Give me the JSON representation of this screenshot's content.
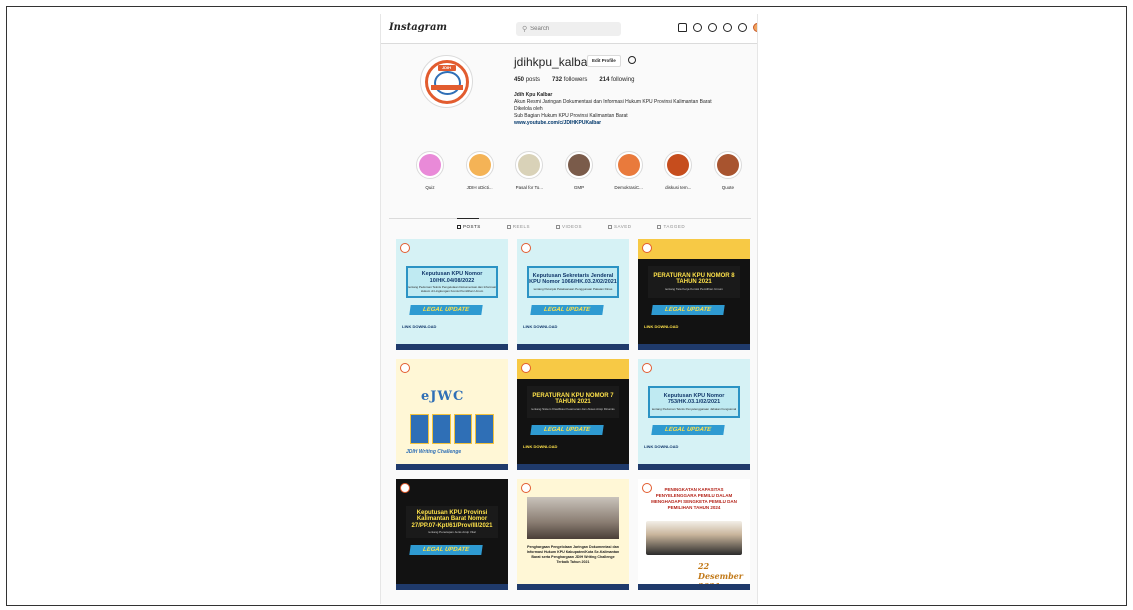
{
  "nav": {
    "logo": "Instagram",
    "search_placeholder": "Search",
    "icons": [
      "home-icon",
      "messenger-icon",
      "new-post-icon",
      "explore-icon",
      "heart-icon",
      "profile-avatar"
    ]
  },
  "profile": {
    "username": "jdihkpu_kalbar",
    "edit_label": "Edit Profile",
    "posts_count": "450",
    "posts_label": "posts",
    "followers_count": "732",
    "followers_label": "followers",
    "following_count": "214",
    "following_label": "following",
    "bio_name": "Jdih Kpu Kalbar",
    "bio_line1": "Akun Resmi Jaringan Dokumentasi dan Informasi Hukum KPU Provinsi Kalimantan Barat",
    "bio_line2": "Dikelola oleh",
    "bio_line3": "Sub Bagian Hukum KPU Provinsi Kalimantan Barat",
    "bio_link": "www.youtube.com/c/JDIHKPUKalbar"
  },
  "highlights": [
    {
      "label": "Quiz",
      "color": "#e98ad8"
    },
    {
      "label": "JDIH xDicti...",
      "color": "#f4b356"
    },
    {
      "label": "Pasal for To...",
      "color": "#d9d2b8"
    },
    {
      "label": "GMP",
      "color": "#7a5b4a"
    },
    {
      "label": "DemokrasiC...",
      "color": "#e97a3c"
    },
    {
      "label": "diskusi tem...",
      "color": "#c64d1d"
    },
    {
      "label": "Quote",
      "color": "#a8542f"
    }
  ],
  "tabs": [
    {
      "label": "POSTS",
      "active": true
    },
    {
      "label": "REELS",
      "active": false
    },
    {
      "label": "VIDEOS",
      "active": false
    },
    {
      "label": "SAVED",
      "active": false
    },
    {
      "label": "TAGGED",
      "active": false
    }
  ],
  "posts": [
    {
      "style": "teal",
      "title": "Keputusan KPU Nomor 10/HK.04/08/2022",
      "sub": "tentang Pedoman Teknis Pengelolaan Dokumentasi dan Informasi Hukum di Lingkungan Komisi Pemilihan Umum",
      "banner": "LEGAL UPDATE",
      "ld": "LINK DOWNLOAD"
    },
    {
      "style": "teal",
      "title": "Keputusan Sekretaris Jenderal KPU Nomor 1066/HK.03.2/02/2021",
      "sub": "tentang Petunjuk Pelaksanaan Penggunaan Pakaian Dinas",
      "banner": "LEGAL UPDATE",
      "ld": "LINK DOWNLOAD"
    },
    {
      "style": "dark yellowtop",
      "title": "PERATURAN KPU NOMOR 8 TAHUN 2021",
      "sub": "tentang Tata Kerja Komisi Pemilihan Umum",
      "banner": "LEGAL UPDATE",
      "ld": "LINK DOWNLOAD"
    },
    {
      "style": "cream",
      "special": "ejwc",
      "logo": "eJWC",
      "caption": "JDIH Writing Challenge"
    },
    {
      "style": "dark yellowtop",
      "title": "PERATURAN KPU NOMOR 7 TAHUN 2021",
      "sub": "tentang Sistem Klasifikasi Keamanan dan Akses Arsip Dinamis",
      "banner": "LEGAL UPDATE",
      "ld": "LINK DOWNLOAD"
    },
    {
      "style": "teal",
      "title": "Keputusan KPU Nomor 753/HK.03.1/02/2021",
      "sub": "tentang Pedoman Teknis Penyelenggaraan Jabatan Fungsional",
      "banner": "LEGAL UPDATE",
      "ld": "LINK DOWNLOAD"
    },
    {
      "style": "dark",
      "title": "Keputusan KPU Provinsi Kalimantan Barat Nomor 27/PP.07-Kpt/61/Prov/III/2021",
      "sub": "tentang Penetapan Jenis Arsip Vital",
      "banner": "LEGAL UPDATE",
      "ld": ""
    },
    {
      "style": "cream",
      "special": "photo",
      "caption": "Penghargaan Pengelolaan Jaringan Dokumentasi dan Informasi Hukum KPU Kabupaten/Kota Se-Kalimantan Barat serta Penghargaan JDIH Writing Challenge Terbaik Tahun 2021"
    },
    {
      "style": "white",
      "special": "pk",
      "title": "PENINGKATAN KAPASITAS PENYELENGGARA PEMILU DALAM MENGHADAPI SENGKETA PEMILU DAN PEMILIHAN TAHUN 2024",
      "date": "22 Desember 2021"
    }
  ]
}
